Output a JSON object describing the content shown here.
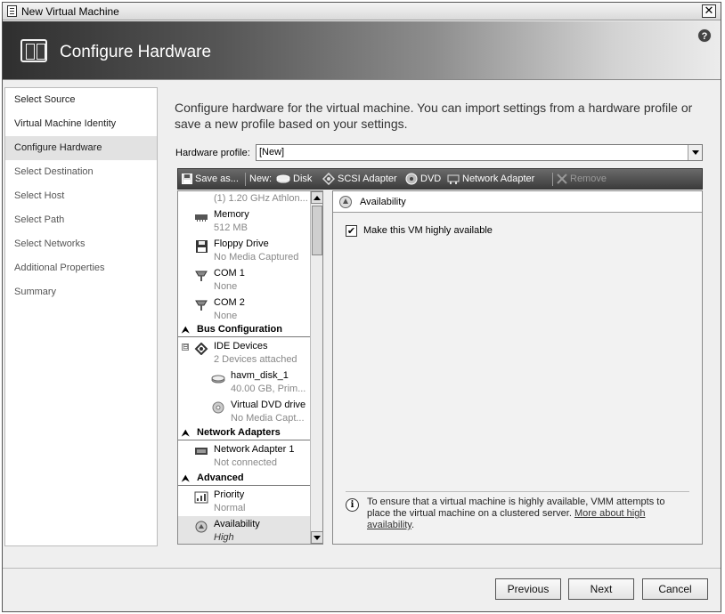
{
  "window": {
    "title": "New Virtual Machine",
    "close_glyph": "✕"
  },
  "header": {
    "title": "Configure Hardware",
    "help_glyph": "?"
  },
  "nav": {
    "items": [
      {
        "label": "Select Source"
      },
      {
        "label": "Virtual Machine Identity"
      },
      {
        "label": "Configure Hardware"
      },
      {
        "label": "Select Destination"
      },
      {
        "label": "Select Host"
      },
      {
        "label": "Select Path"
      },
      {
        "label": "Select Networks"
      },
      {
        "label": "Additional Properties"
      },
      {
        "label": "Summary"
      }
    ],
    "active_index": 2
  },
  "main": {
    "intro": "Configure hardware for the virtual machine. You can import settings from a hardware profile or save a new profile based on your settings.",
    "hardware_profile_label": "Hardware profile:",
    "hardware_profile_value": "[New]"
  },
  "toolbar": {
    "save_as": "Save as...",
    "new_label": "New:",
    "disk": "Disk",
    "scsi": "SCSI Adapter",
    "dvd": "DVD",
    "network": "Network Adapter",
    "remove": "Remove"
  },
  "tree": {
    "cpu_sub": "(1) 1.20 GHz Athlon...",
    "memory": {
      "label": "Memory",
      "sub": "512 MB",
      "icon": "memory-icon"
    },
    "floppy": {
      "label": "Floppy Drive",
      "sub": "No Media Captured",
      "icon": "floppy-icon"
    },
    "com1": {
      "label": "COM 1",
      "sub": "None",
      "icon": "com-port-icon"
    },
    "com2": {
      "label": "COM 2",
      "sub": "None",
      "icon": "com-port-icon"
    },
    "bus_group": "Bus Configuration",
    "ide": {
      "label": "IDE Devices",
      "sub": "2 Devices attached",
      "expander": "⊟"
    },
    "disk1": {
      "label": "havm_disk_1",
      "sub": "40.00 GB, Prim..."
    },
    "dvd1": {
      "label": "Virtual DVD drive",
      "sub": "No Media Capt..."
    },
    "net_group": "Network Adapters",
    "net1": {
      "label": "Network Adapter 1",
      "sub": "Not connected"
    },
    "adv_group": "Advanced",
    "priority": {
      "label": "Priority",
      "sub": "Normal"
    },
    "availability": {
      "label": "Availability",
      "sub": "High"
    },
    "chevron_glyph": "⮝"
  },
  "details": {
    "header": "Availability",
    "checkbox_label": "Make this VM highly available",
    "checkbox_checked": true,
    "check_glyph": "✔",
    "info_text": "To ensure that a virtual machine is highly available, VMM attempts to place the virtual machine on a clustered server. ",
    "info_link": "More about high availability",
    "info_end": ".",
    "info_glyph": "i"
  },
  "footer": {
    "previous": "Previous",
    "next": "Next",
    "cancel": "Cancel"
  }
}
